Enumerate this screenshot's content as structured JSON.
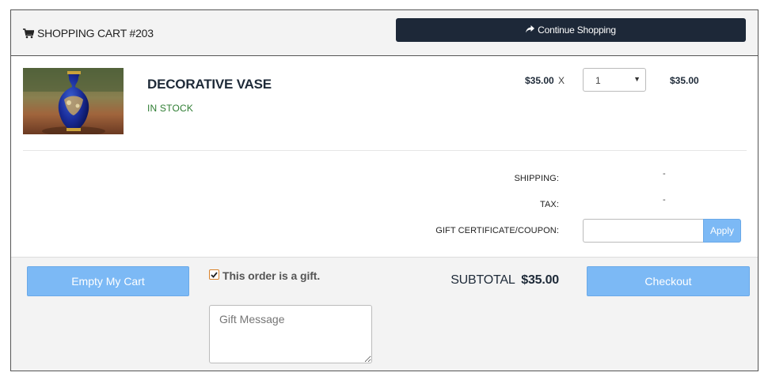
{
  "header": {
    "title": "SHOPPING CART #203",
    "continue_label": "Continue Shopping"
  },
  "item": {
    "name": "DECORATIVE VASE",
    "stock_status": "IN STOCK",
    "unit_price": "$35.00",
    "times_symbol": "X",
    "quantity": "1",
    "line_total": "$35.00"
  },
  "summary": {
    "shipping_label": "SHIPPING:",
    "shipping_value": "-",
    "tax_label": "TAX:",
    "tax_value": "-",
    "coupon_label": "GIFT CERTIFICATE/COUPON:",
    "coupon_value": "",
    "apply_label": "Apply"
  },
  "footer": {
    "empty_label": "Empty My Cart",
    "gift_checked": true,
    "gift_label": "This order is a gift.",
    "gift_message_placeholder": "Gift Message",
    "subtotal_label": "SUBTOTAL",
    "subtotal_value": "$35.00",
    "checkout_label": "Checkout"
  },
  "colors": {
    "primary_dark": "#1d2838",
    "button_blue": "#7cb9f5",
    "in_stock_green": "#2e7d32",
    "checkbox_orange": "#d9822b"
  },
  "icons": {
    "cart": "cart-icon",
    "continue": "share-arrow-icon",
    "dropdown": "chevron-down-icon",
    "checkbox": "checkmark-icon"
  }
}
